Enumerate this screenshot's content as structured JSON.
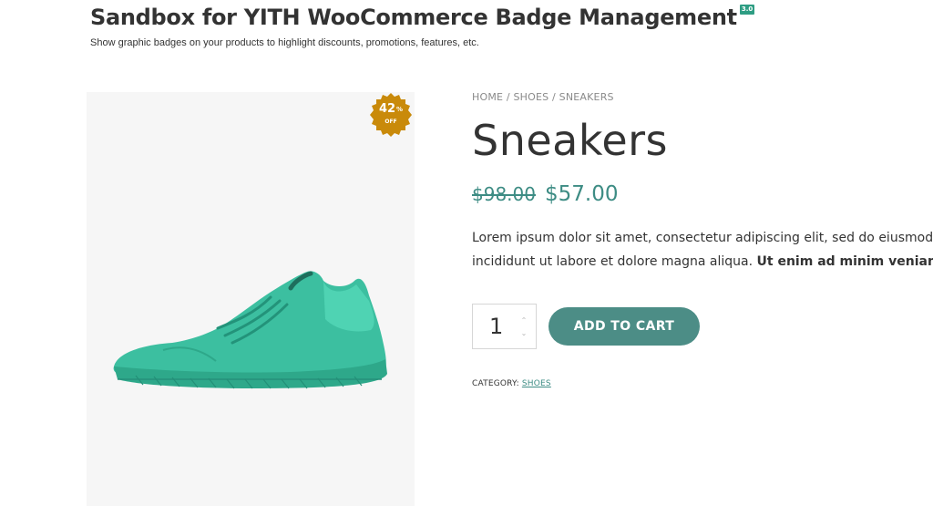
{
  "site": {
    "title": "Sandbox for YITH WooCommerce Badge Management",
    "version_badge": "3.0",
    "tagline": "Show graphic badges on your products to highlight discounts, promotions, features, etc."
  },
  "badge": {
    "percent": "42",
    "percent_symbol": "%",
    "off_label": "OFF",
    "color": "#c98a0a"
  },
  "breadcrumb": {
    "items": [
      "HOME",
      "SHOES",
      "SNEAKERS"
    ],
    "separator": " / "
  },
  "product": {
    "title": "Sneakers",
    "old_price": "$98.00",
    "new_price": "$57.00",
    "description_line1": "Lorem ipsum dolor sit amet, consectetur adipiscing elit, sed do eiusmod",
    "description_line2_plain": "incididunt ut labore et dolore magna aliqua. ",
    "description_line2_bold": "Ut enim ad minim veniam,",
    "image_icon": "sneaker-image"
  },
  "cart": {
    "quantity": "1",
    "add_to_cart_label": "ADD TO CART"
  },
  "meta": {
    "category_label": "CATEGORY:",
    "category_value": "SHOES"
  },
  "colors": {
    "accent": "#3d8c84",
    "button": "#4c8d86",
    "shoe": "#3cbfa0"
  }
}
